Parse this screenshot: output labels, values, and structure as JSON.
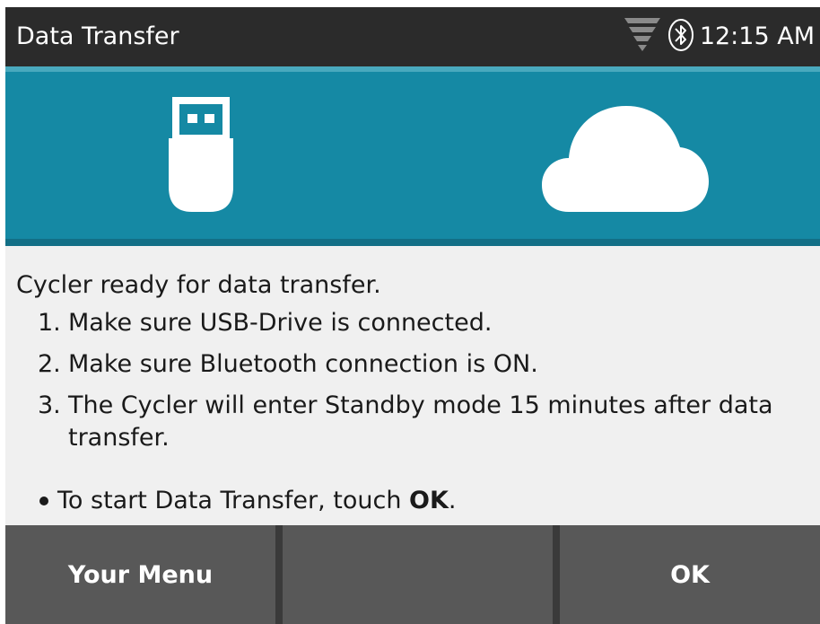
{
  "status_bar": {
    "title": "Data Transfer",
    "time": "12:15 AM",
    "icons": [
      "signal-icon",
      "bluetooth-icon"
    ]
  },
  "hero": {
    "background_color": "#1589a4",
    "icons": [
      "usb-drive-icon",
      "cloud-icon"
    ]
  },
  "content": {
    "intro": "Cycler ready for data transfer.",
    "steps": [
      {
        "num": "1.",
        "text": "Make sure USB-Drive is connected."
      },
      {
        "num": "2.",
        "text": "Make sure Bluetooth connection is ON."
      },
      {
        "num": "3.",
        "text": "The Cycler will enter Standby mode 15 minutes after data transfer."
      }
    ],
    "bullet_prefix": "To start Data Transfer, touch ",
    "bullet_bold": "OK",
    "bullet_suffix": "."
  },
  "softkeys": {
    "left_label": "Your Menu",
    "middle_label": "",
    "right_label": "OK"
  }
}
